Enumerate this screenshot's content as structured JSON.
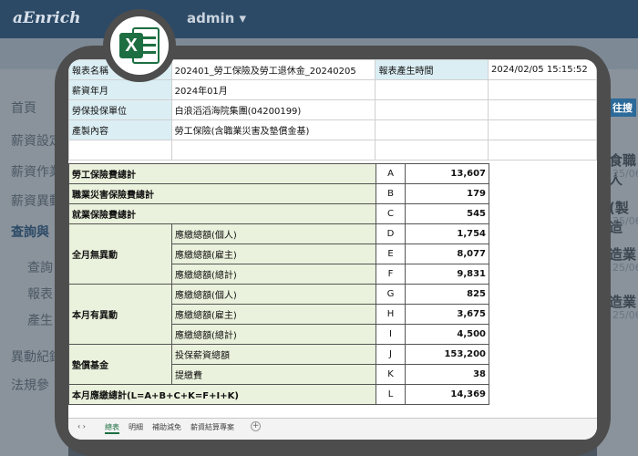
{
  "background": {
    "logo": "aEnrich",
    "user": "admin ▾",
    "sidebar": [
      "首頁",
      "薪資設定",
      "薪資作業",
      "薪資異動",
      "查詢與",
      "查詢",
      "報表",
      "產生",
      "異動紀錄",
      "法規參"
    ],
    "right_items": [
      {
        "title": "食職人",
        "date": "25/06"
      },
      {
        "title": "(製造",
        "date": "25/06"
      },
      {
        "title": "造業",
        "date": "25/06"
      },
      {
        "title": "造業",
        "date": "25/06"
      }
    ],
    "right_button": "往搜"
  },
  "header": {
    "rows": [
      {
        "label": "報表名稱",
        "value": "202401_勞工保險及勞工退休金_20240205",
        "label2": "報表產生時間",
        "value2": "2024/02/05  15:15:52"
      },
      {
        "label": "薪資年月",
        "value": "2024年01月"
      },
      {
        "label": "勞保投保單位",
        "value": "白浪滔滔海院集團(04200199)"
      },
      {
        "label": "產製內容",
        "value": "勞工保險(含職業災害及墊償金基)"
      }
    ]
  },
  "table": {
    "groups": [
      {
        "group": "勞工保險費總計",
        "item": "",
        "code": "A",
        "amount": "13,607"
      },
      {
        "group": "職業災害保險費總計",
        "item": "",
        "code": "B",
        "amount": "179"
      },
      {
        "group": "就業保險費總計",
        "item": "",
        "code": "C",
        "amount": "545"
      },
      {
        "group": "全月無異動",
        "item": "應繳總額(個人)",
        "code": "D",
        "amount": "1,754"
      },
      {
        "group": "",
        "item": "應繳總額(雇主)",
        "code": "E",
        "amount": "8,077"
      },
      {
        "group": "",
        "item": "應繳總額(總計)",
        "code": "F",
        "amount": "9,831"
      },
      {
        "group": "本月有異動",
        "item": "應繳總額(個人)",
        "code": "G",
        "amount": "825"
      },
      {
        "group": "",
        "item": "應繳總額(雇主)",
        "code": "H",
        "amount": "3,675"
      },
      {
        "group": "",
        "item": "應繳總額(總計)",
        "code": "I",
        "amount": "4,500"
      },
      {
        "group": "墊償基金",
        "item": "投保薪資總額",
        "code": "J",
        "amount": "153,200"
      },
      {
        "group": "",
        "item": "提繳費",
        "code": "K",
        "amount": "38"
      },
      {
        "group": "本月應繳總計(L=A+B+C+K=F+I+K)",
        "item": "",
        "code": "L",
        "amount": "14,369"
      }
    ]
  },
  "sheet_tabs": [
    "總表",
    "明細",
    "補助減免",
    "薪資結算專案"
  ],
  "colors": {
    "excel_green": "#1d6f42",
    "header_blue": "#dbeef4",
    "group_green": "#eaf1dc"
  }
}
